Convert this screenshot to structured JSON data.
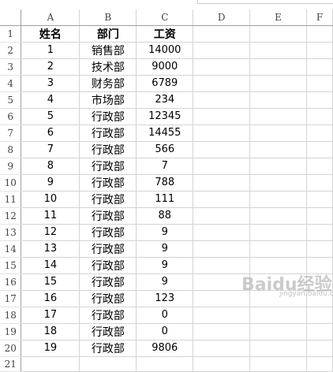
{
  "columns": [
    "A",
    "B",
    "C",
    "D",
    "E",
    "F"
  ],
  "header_row": {
    "row_number": "1",
    "a": "姓名",
    "b": "部门",
    "c": "工资"
  },
  "rows": [
    {
      "n": "2",
      "a": "1",
      "b": "销售部",
      "c": "14000"
    },
    {
      "n": "3",
      "a": "2",
      "b": "技术部",
      "c": "9000"
    },
    {
      "n": "4",
      "a": "3",
      "b": "财务部",
      "c": "6789"
    },
    {
      "n": "5",
      "a": "4",
      "b": "市场部",
      "c": "234"
    },
    {
      "n": "6",
      "a": "5",
      "b": "行政部",
      "c": "12345"
    },
    {
      "n": "7",
      "a": "6",
      "b": "行政部",
      "c": "14455"
    },
    {
      "n": "8",
      "a": "7",
      "b": "行政部",
      "c": "566"
    },
    {
      "n": "9",
      "a": "8",
      "b": "行政部",
      "c": "7"
    },
    {
      "n": "10",
      "a": "9",
      "b": "行政部",
      "c": "788"
    },
    {
      "n": "11",
      "a": "10",
      "b": "行政部",
      "c": "111"
    },
    {
      "n": "12",
      "a": "11",
      "b": "行政部",
      "c": "88"
    },
    {
      "n": "13",
      "a": "12",
      "b": "行政部",
      "c": "9"
    },
    {
      "n": "14",
      "a": "13",
      "b": "行政部",
      "c": "9"
    },
    {
      "n": "15",
      "a": "14",
      "b": "行政部",
      "c": "9"
    },
    {
      "n": "16",
      "a": "15",
      "b": "行政部",
      "c": "9"
    },
    {
      "n": "17",
      "a": "16",
      "b": "行政部",
      "c": "123"
    },
    {
      "n": "18",
      "a": "17",
      "b": "行政部",
      "c": "0"
    },
    {
      "n": "19",
      "a": "18",
      "b": "行政部",
      "c": "0"
    },
    {
      "n": "20",
      "a": "19",
      "b": "行政部",
      "c": "9806"
    }
  ],
  "last_row_number": "21",
  "watermark": {
    "text": "Baidu经验",
    "sub": "jingyan.baidu.com"
  }
}
